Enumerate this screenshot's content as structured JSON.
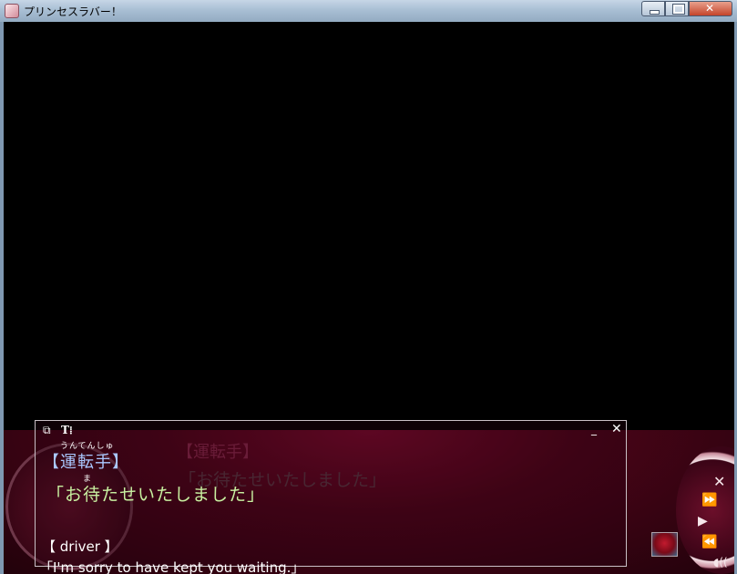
{
  "window": {
    "title": "プリンセスラバー！",
    "icons": {
      "app": "app-icon",
      "minimize": "minimize-icon",
      "maximize": "maximize-icon",
      "close": "close-icon"
    }
  },
  "background": {
    "ghost_name": "【運転手】",
    "ghost_line": "「お待たせいたしました」"
  },
  "message_window": {
    "toolbar": {
      "restore_icon": "⧉",
      "text_icon": "T⁞",
      "minimize_icon": "_",
      "close_icon": "✕"
    },
    "ruby_name": "うんてんしゅ",
    "jp_name": "【運転手】",
    "ruby_ma": "ま",
    "jp_line": "「お待たせいたしました」",
    "en_name": "【 driver 】",
    "en_line": "「I'm sorry to have kept you waiting.」"
  },
  "controls": {
    "close_icon": "✕",
    "fast_forward_icon": "⏩",
    "play_icon": "▶",
    "rewind_icon": "⏪",
    "voice_icon": "◖((",
    "thumbnail": "rose-thumbnail-icon"
  },
  "colors": {
    "name_jp": "#aac8ff",
    "line_jp": "#c8f0a0",
    "accent": "#7a0a2c"
  }
}
